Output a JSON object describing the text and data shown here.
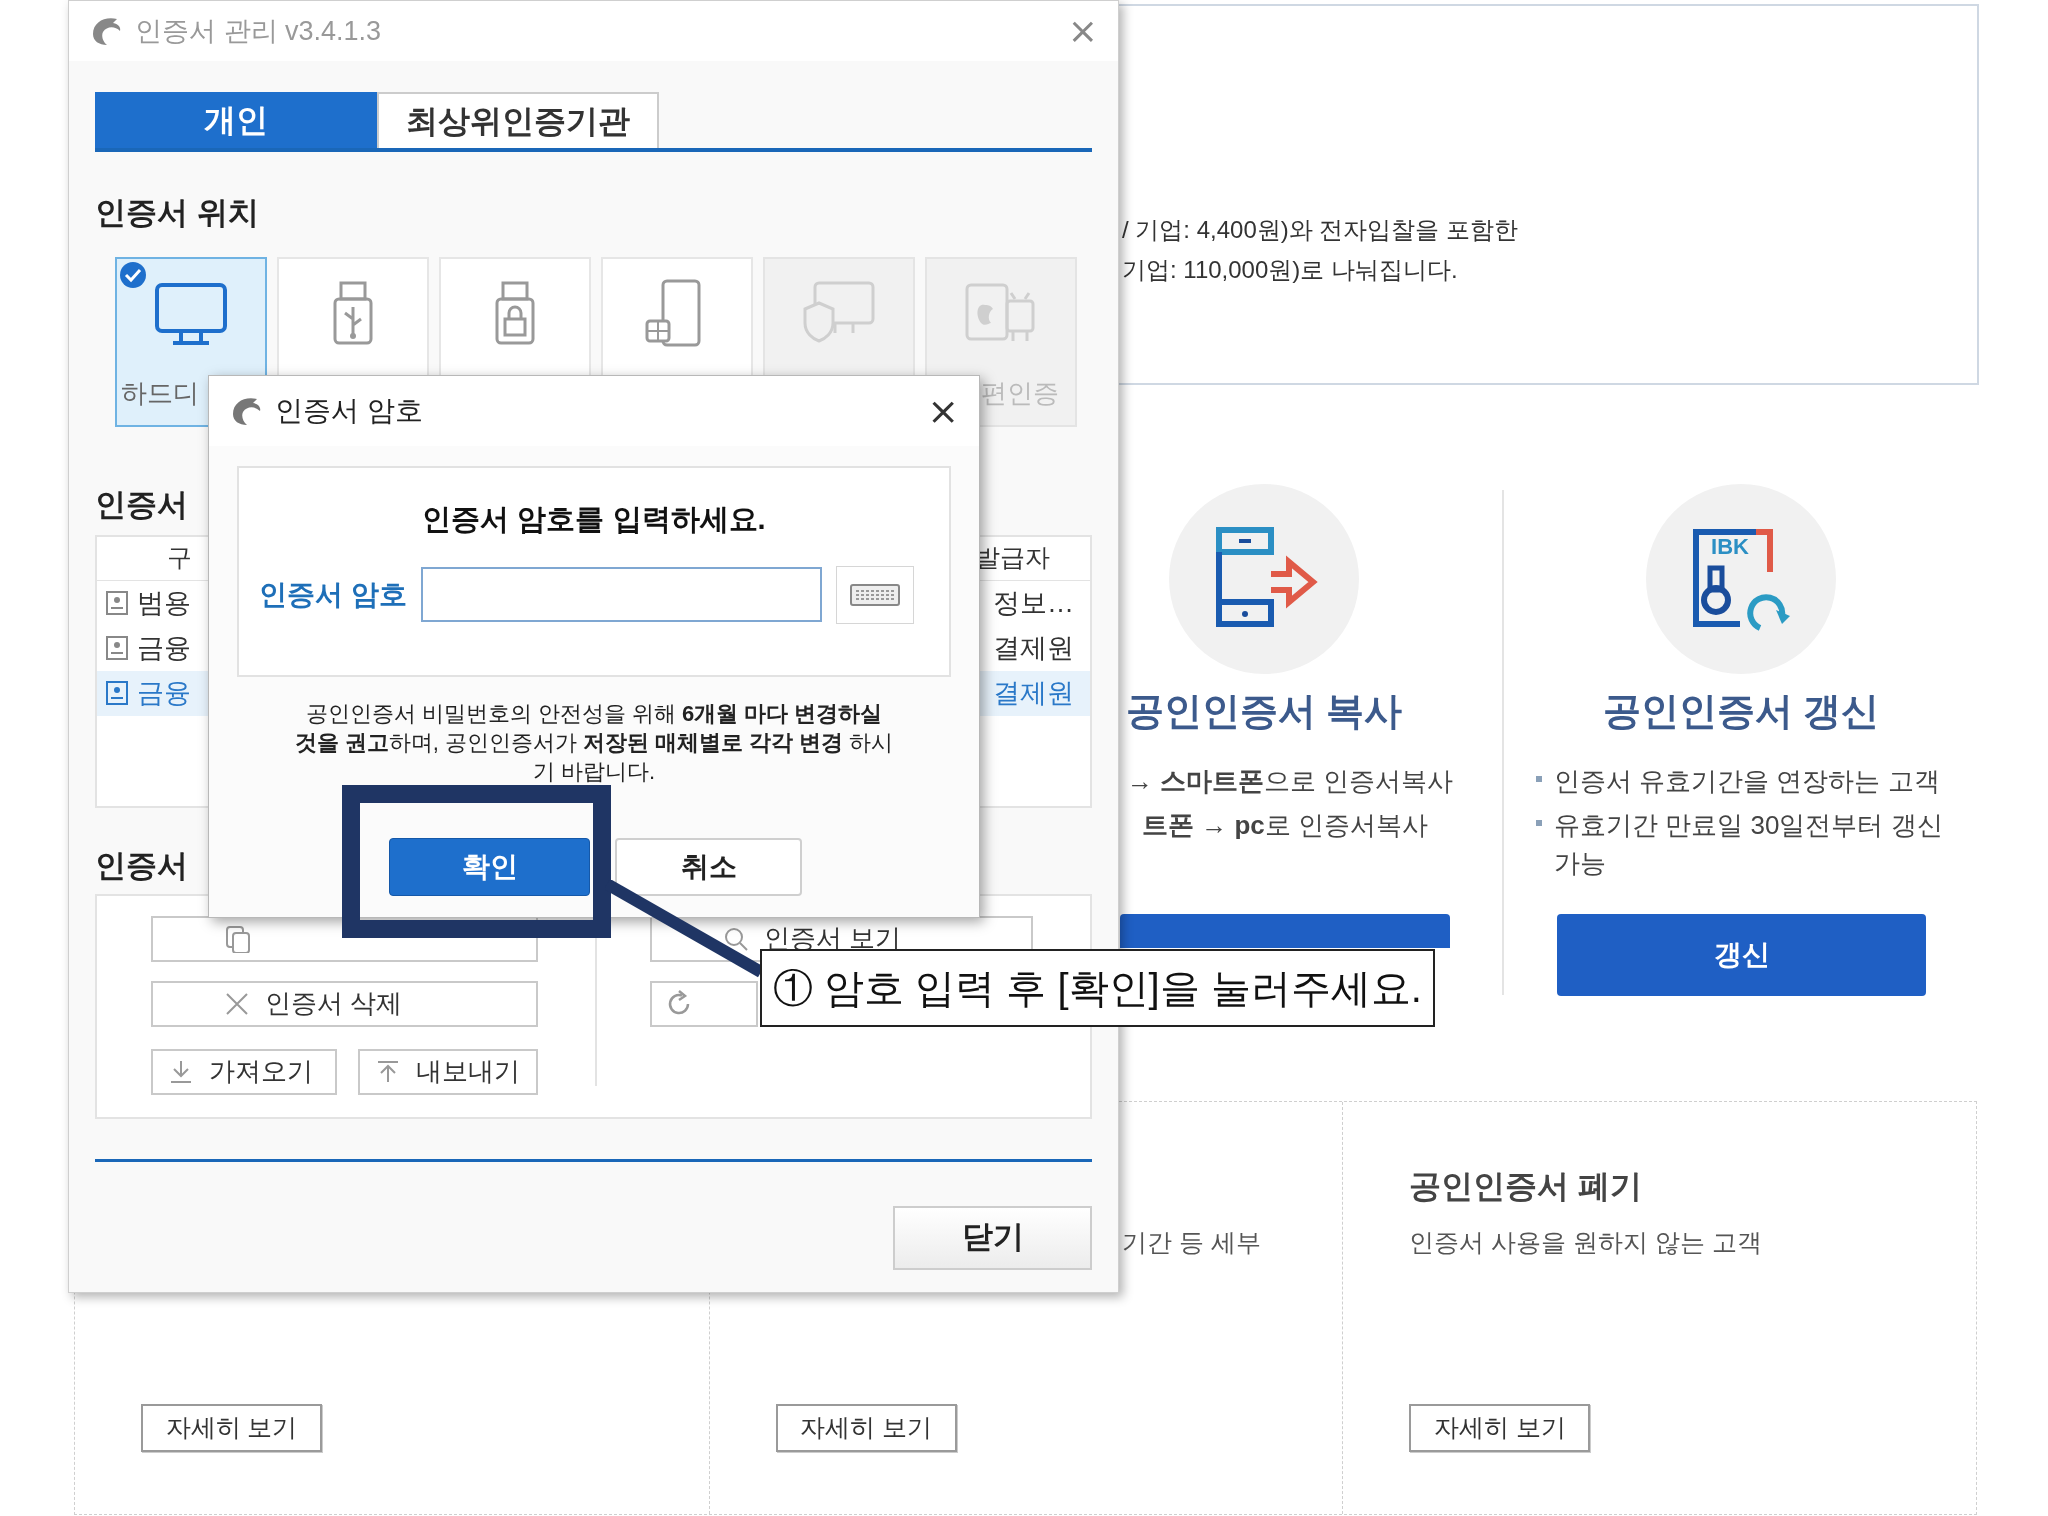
{
  "background_page": {
    "intro_lines": [
      "/ 기업: 4,400원)와 전자입찰을 포함한",
      "기업: 110,000원)로 나눠집니다."
    ],
    "copy_service": {
      "title": "공인인증서 복사",
      "lines": [
        "→ **스마트폰**으로 인증서복사",
        "**트폰** → **pc**로 인증서복사"
      ]
    },
    "renew_service": {
      "icon_label": "IBK",
      "title": "공인인증서 갱신",
      "bullets": [
        "인증서 유효기간을 연장하는 고객",
        "유효기간 만료일 30일전부터 갱신 가능"
      ],
      "button": "갱신"
    },
    "bottom_cards": [
      {
        "button": "자세히 보기"
      },
      {
        "desc": "기간 등 세부",
        "button": "자세히 보기"
      },
      {
        "title": "공인인증서 폐기",
        "desc": "인증서 사용을 원하지 않는 고객",
        "button": "자세히 보기"
      }
    ]
  },
  "app_window": {
    "title": "인증서 관리 v3.4.1.3",
    "close_icon": "×",
    "tabs": [
      {
        "label": "개인",
        "selected": true
      },
      {
        "label": "최상위인증기관",
        "selected": false
      }
    ],
    "location_heading": "인증서 위치",
    "locations": [
      {
        "kind": "monitor",
        "label": "하드디",
        "selected": true,
        "disabled": false
      },
      {
        "kind": "usb",
        "selected": false,
        "disabled": false
      },
      {
        "kind": "lock",
        "selected": false,
        "disabled": false
      },
      {
        "kind": "phone",
        "selected": false,
        "disabled": false
      },
      {
        "kind": "secure-pc",
        "selected": false,
        "disabled": true
      },
      {
        "kind": "mobile",
        "label": "편인증",
        "selected": false,
        "disabled": true
      }
    ],
    "cert_heading": "인증서",
    "table": {
      "columns": [
        "구",
        "발급자"
      ],
      "rows": [
        {
          "type": "범용",
          "issuer": "정보…",
          "selected": false
        },
        {
          "type": "금융",
          "issuer": "결제원",
          "selected": false
        },
        {
          "type": "금융",
          "issuer": "결제원",
          "selected": true
        }
      ]
    },
    "actions_heading": "인증서",
    "actions": [
      {
        "kind": "copy"
      },
      {
        "kind": "delete",
        "label": "인증서 삭제"
      },
      {
        "kind": "import",
        "label": "가져오기"
      },
      {
        "kind": "export",
        "label": "내보내기"
      },
      {
        "kind": "view",
        "label": "인증서 보기"
      },
      {
        "kind": "refresh"
      }
    ],
    "close_button": "닫기"
  },
  "dialog": {
    "title": "인증서 암호",
    "close_icon": "×",
    "prompt": "인증서 암호를 입력하세요.",
    "field_label": "인증서 암호",
    "notice": "공인인증서 비밀번호의 안전성을 위해 **6개월 마다 변경하실 것을 권고**하며, 공인인증서가 **저장된 매체별로 각각 변경** 하시기 바랍니다.",
    "ok_button": "확인",
    "cancel_button": "취소"
  },
  "callout": {
    "text": "① 암호 입력 후 [확인]을 눌러주세요."
  }
}
